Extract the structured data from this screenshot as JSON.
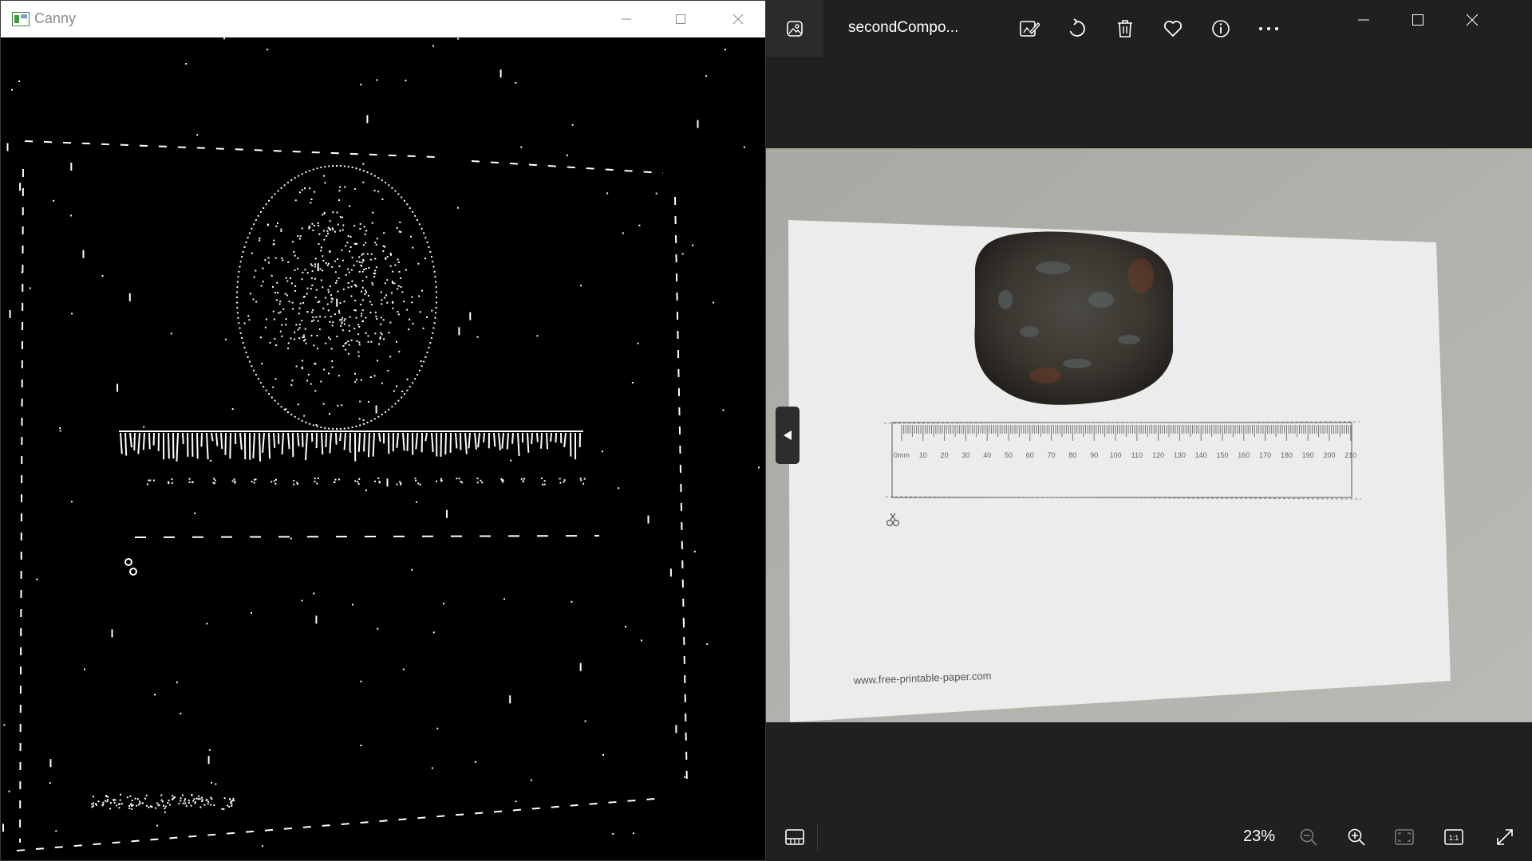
{
  "canny": {
    "title": "Canny",
    "icons": {
      "app": "opencv-window-icon",
      "minimize": "minimize-icon",
      "maximize": "maximize-icon",
      "close": "close-icon"
    }
  },
  "photos": {
    "filename": "secondCompo...",
    "toolbar": [
      "edit-icon",
      "rotate-icon",
      "delete-icon",
      "favorite-icon",
      "info-icon",
      "more-icon"
    ],
    "zoom": "23%",
    "photo": {
      "ruler_numbers": [
        "0mm",
        "10",
        "20",
        "30",
        "40",
        "50",
        "60",
        "70",
        "80",
        "90",
        "100",
        "110",
        "120",
        "130",
        "140",
        "150",
        "160",
        "170",
        "180",
        "190",
        "200",
        "210"
      ],
      "watermark": "www.free-printable-paper.com"
    }
  },
  "colors": {
    "photos_bg": "#202020",
    "canny_bg": "#000000",
    "paper": "#eeeeee",
    "table": "#b0b2ac",
    "stone": "#3a3630"
  }
}
